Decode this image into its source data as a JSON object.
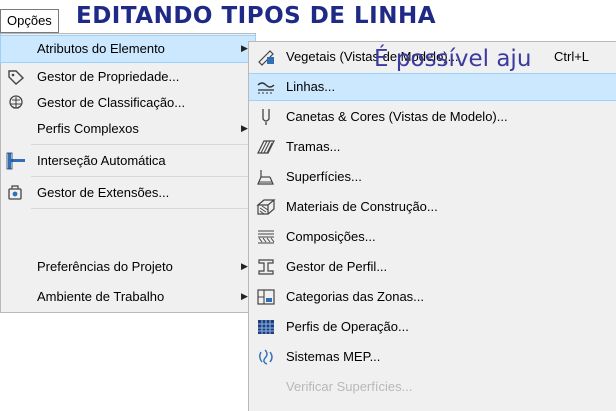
{
  "overlay": {
    "title": "EDITANDO TIPOS DE LINHA",
    "subtitle": "É possível aju"
  },
  "menubar": {
    "label": "Opções"
  },
  "main_menu": {
    "items": [
      {
        "label": "Atributos do Elemento",
        "icon": "none",
        "submenu": true,
        "selected": true
      },
      {
        "label": "Gestor de Propriedade...",
        "icon": "tag-icon",
        "submenu": false
      },
      {
        "label": "Gestor de Classificação...",
        "icon": "classification-icon",
        "submenu": false
      },
      {
        "label": "Perfis Complexos",
        "icon": "none",
        "submenu": true
      },
      {
        "label": "Interseção Automática",
        "icon": "intersection-icon",
        "submenu": false
      },
      {
        "label": "Gestor de Extensões...",
        "icon": "extensions-icon",
        "submenu": false
      },
      {
        "label": "Preferências do Projeto",
        "icon": "none",
        "submenu": true
      },
      {
        "label": "Ambiente de Trabalho",
        "icon": "none",
        "submenu": true
      }
    ]
  },
  "sub_menu": {
    "items": [
      {
        "label": "Vegetais (Vistas de Modelo)...",
        "shortcut": "Ctrl+L",
        "icon": "pens-icon"
      },
      {
        "label": "Linhas...",
        "icon": "lines-icon",
        "selected": true
      },
      {
        "label": "Canetas & Cores (Vistas de Modelo)...",
        "icon": "pen-colors-icon"
      },
      {
        "label": "Tramas...",
        "icon": "fills-icon"
      },
      {
        "label": "Superfícies...",
        "icon": "surfaces-icon"
      },
      {
        "label": "Materiais de Construção...",
        "icon": "building-materials-icon"
      },
      {
        "label": "Composições...",
        "icon": "composites-icon"
      },
      {
        "label": "Gestor de Perfil...",
        "icon": "profile-manager-icon"
      },
      {
        "label": "Categorias das Zonas...",
        "icon": "zone-categories-icon"
      },
      {
        "label": "Perfis de Operação...",
        "icon": "operation-profiles-icon"
      },
      {
        "label": "Sistemas MEP...",
        "icon": "mep-systems-icon"
      },
      {
        "label": "Verificar Superfícies...",
        "icon": "none",
        "faded": true
      }
    ]
  },
  "colors": {
    "highlight": "#cce8ff",
    "menu_bg": "#f0f0f0",
    "title": "#1f2a86"
  }
}
